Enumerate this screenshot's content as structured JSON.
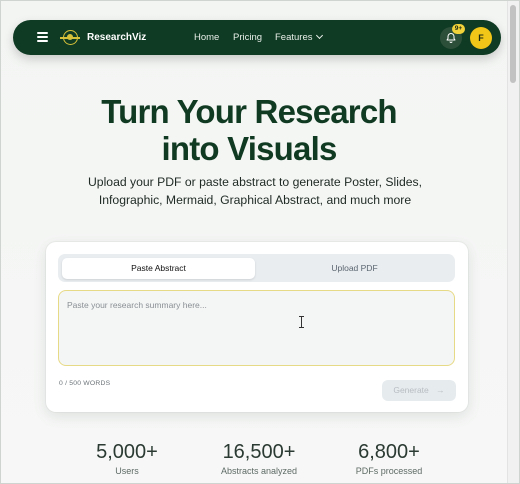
{
  "nav": {
    "brand": "ResearchViz",
    "links": [
      "Home",
      "Pricing",
      "Features"
    ],
    "notification_badge": "9+",
    "avatar_initial": "F",
    "colors": {
      "navbar": "#0f3a23",
      "accent": "#f2c618"
    }
  },
  "hero": {
    "title_line1": "Turn Your Research",
    "title_line2": "into Visuals",
    "subtitle": "Upload your PDF or paste abstract to generate Poster, Slides, Infographic, Mermaid, Graphical Abstract, and much more"
  },
  "card": {
    "tabs": [
      "Paste Abstract",
      "Upload PDF"
    ],
    "active_tab": "Paste Abstract",
    "textarea_placeholder": "Paste your research summary here...",
    "word_count": "0 / 500 WORDS",
    "generate_label": "Generate",
    "generate_arrow": "→"
  },
  "stats": [
    {
      "value": "5,000+",
      "label": "Users"
    },
    {
      "value": "16,500+",
      "label": "Abstracts analyzed"
    },
    {
      "value": "6,800+",
      "label": "PDFs processed"
    }
  ]
}
